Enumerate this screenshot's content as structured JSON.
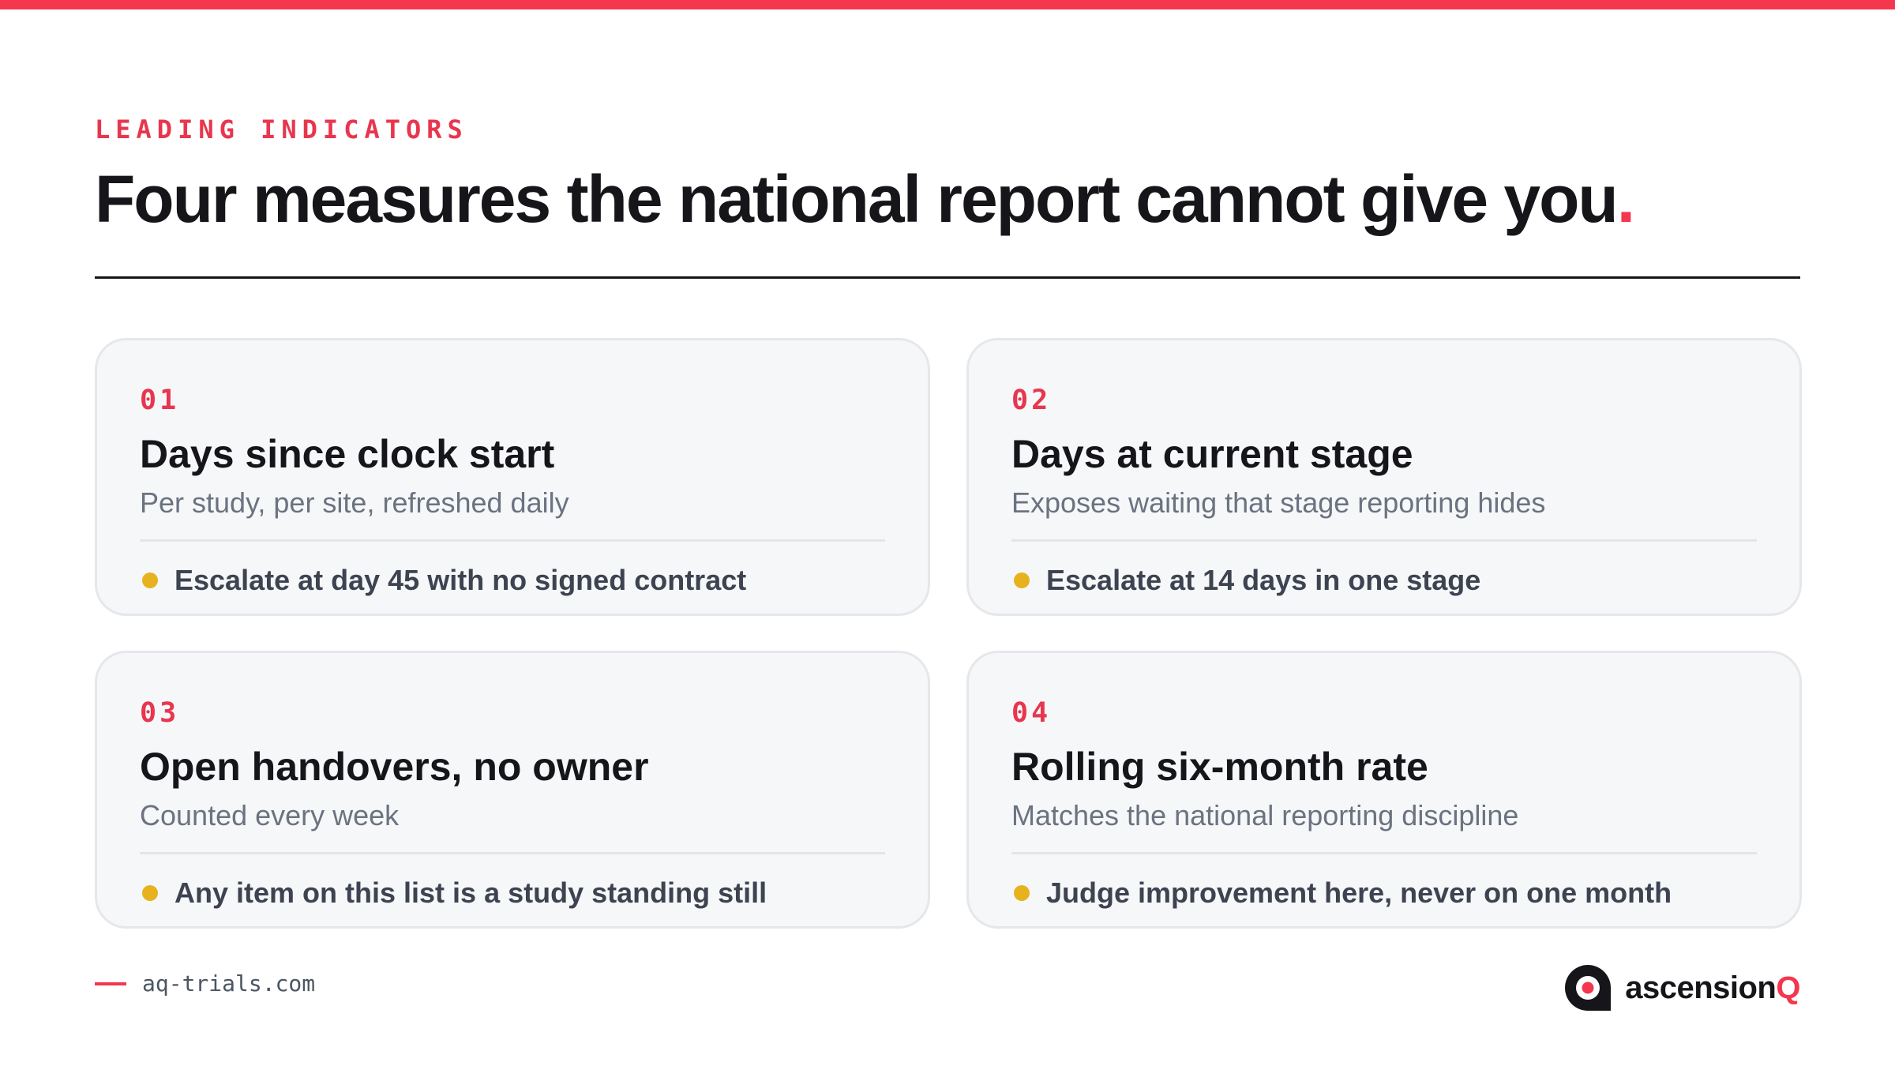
{
  "header": {
    "eyebrow": "LEADING INDICATORS",
    "title": "Four measures the national report cannot give you",
    "title_terminal": "."
  },
  "cards": [
    {
      "number": "01",
      "title": "Days since clock start",
      "subtitle": "Per study, per site, refreshed daily",
      "rule": "Escalate at day 45 with no signed contract"
    },
    {
      "number": "02",
      "title": "Days at current stage",
      "subtitle": "Exposes waiting that stage reporting hides",
      "rule": "Escalate at 14 days in one stage"
    },
    {
      "number": "03",
      "title": "Open handovers, no owner",
      "subtitle": "Counted every week",
      "rule": "Any item on this list is a study standing still"
    },
    {
      "number": "04",
      "title": "Rolling six-month rate",
      "subtitle": "Matches the national reporting discipline",
      "rule": "Judge improvement here, never on one month"
    }
  ],
  "footer": {
    "url": "aq-trials.com",
    "brand_name": "ascension",
    "brand_suffix": "Q",
    "brand_icon": "ascensionq-logo-mark"
  },
  "colors": {
    "accent": "#f4374f",
    "bullet": "#e6b31e",
    "text": "#16161a",
    "muted": "#6b7280",
    "card_bg": "#f6f7f9"
  }
}
